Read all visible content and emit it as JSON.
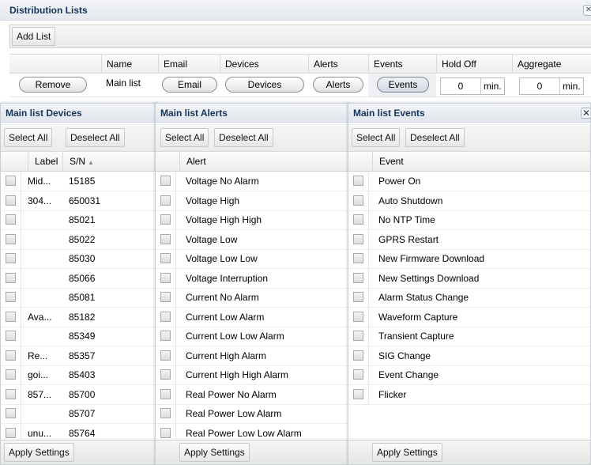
{
  "header": {
    "title": "Distribution Lists"
  },
  "toolbar": {
    "add_list_label": "Add List"
  },
  "dist_table": {
    "columns": [
      "Name",
      "Email",
      "Devices",
      "Alerts",
      "Events",
      "Hold Off",
      "Aggregate"
    ],
    "row": {
      "remove_label": "Remove",
      "name": "Main list",
      "email_label": "Email",
      "devices_label": "Devices",
      "alerts_label": "Alerts",
      "events_label": "Events",
      "hold_off_value": "0",
      "hold_off_unit": "min.",
      "aggregate_value": "0",
      "aggregate_unit": "min."
    }
  },
  "devices_panel": {
    "title": "Main list Devices",
    "select_all": "Select All",
    "deselect_all": "Deselect All",
    "columns": [
      "Label",
      "S/N"
    ],
    "rows": [
      {
        "label": "Mid...",
        "sn": "15185"
      },
      {
        "label": "304...",
        "sn": "650031"
      },
      {
        "label": "",
        "sn": "85021"
      },
      {
        "label": "",
        "sn": "85022"
      },
      {
        "label": "",
        "sn": "85030"
      },
      {
        "label": "",
        "sn": "85066"
      },
      {
        "label": "",
        "sn": "85081"
      },
      {
        "label": "Ava...",
        "sn": "85182"
      },
      {
        "label": "",
        "sn": "85349"
      },
      {
        "label": "Re...",
        "sn": "85357"
      },
      {
        "label": "goi...",
        "sn": "85403"
      },
      {
        "label": "857...",
        "sn": "85700"
      },
      {
        "label": "",
        "sn": "85707"
      },
      {
        "label": "unu...",
        "sn": "85764"
      }
    ],
    "apply": "Apply Settings"
  },
  "alerts_panel": {
    "title": "Main list Alerts",
    "select_all": "Select All",
    "deselect_all": "Deselect All",
    "column": "Alert",
    "rows": [
      "Voltage No Alarm",
      "Voltage High",
      "Voltage High High",
      "Voltage Low",
      "Voltage Low Low",
      "Voltage Interruption",
      "Current No Alarm",
      "Current Low Alarm",
      "Current Low Low Alarm",
      "Current High Alarm",
      "Current High High Alarm",
      "Real Power No Alarm",
      "Real Power Low Alarm",
      "Real Power Low Low Alarm"
    ],
    "apply": "Apply Settings"
  },
  "events_panel": {
    "title": "Main list Events",
    "select_all": "Select All",
    "deselect_all": "Deselect All",
    "column": "Event",
    "rows": [
      "Power On",
      "Auto Shutdown",
      "No NTP Time",
      "GPRS Restart",
      "New Firmware Download",
      "New Settings Download",
      "Alarm Status Change",
      "Waveform Capture",
      "Transient Capture",
      "SIG Change",
      "Event Change",
      "Flicker"
    ],
    "apply": "Apply Settings"
  },
  "icons": {
    "close": "close-icon",
    "sort": "sort-asc-icon",
    "checkbox": "checkbox-icon"
  }
}
